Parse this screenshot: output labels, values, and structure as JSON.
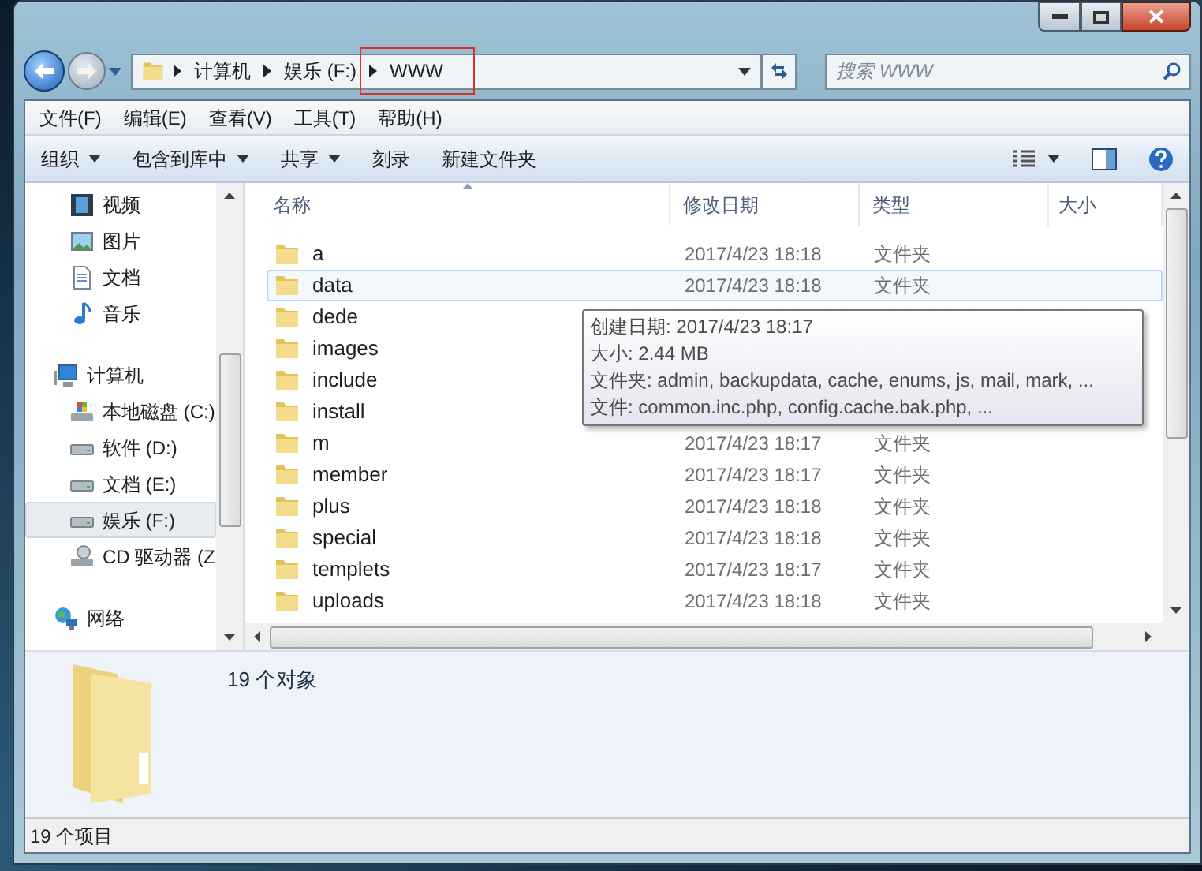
{
  "address_bar": {
    "crumbs": [
      {
        "label": "计算机",
        "highlighted": false
      },
      {
        "label": "娱乐 (F:)",
        "highlighted": false
      },
      {
        "label": "WWW",
        "highlighted": true
      }
    ]
  },
  "search": {
    "placeholder": "搜索 WWW"
  },
  "menu": [
    "文件(F)",
    "编辑(E)",
    "查看(V)",
    "工具(T)",
    "帮助(H)"
  ],
  "toolbar": [
    {
      "label": "组织",
      "dropdown": true
    },
    {
      "label": "包含到库中",
      "dropdown": true
    },
    {
      "label": "共享",
      "dropdown": true
    },
    {
      "label": "刻录",
      "dropdown": false
    },
    {
      "label": "新建文件夹",
      "dropdown": false
    }
  ],
  "nav": [
    {
      "items": [
        {
          "label": "视频",
          "kind": "video",
          "selected": false
        },
        {
          "label": "图片",
          "kind": "picture",
          "selected": false
        },
        {
          "label": "文档",
          "kind": "document",
          "selected": false
        },
        {
          "label": "音乐",
          "kind": "music",
          "selected": false
        }
      ]
    },
    {
      "items": [
        {
          "label": "计算机",
          "kind": "computer",
          "selected": false
        },
        {
          "label": "本地磁盘 (C:)",
          "kind": "system-drive",
          "selected": false
        },
        {
          "label": "软件 (D:)",
          "kind": "drive",
          "selected": false
        },
        {
          "label": "文档 (E:)",
          "kind": "drive",
          "selected": false
        },
        {
          "label": "娱乐 (F:)",
          "kind": "drive",
          "selected": true
        },
        {
          "label": "CD 驱动器 (Z",
          "kind": "cd",
          "selected": false
        }
      ]
    },
    {
      "items": [
        {
          "label": "网络",
          "kind": "network",
          "selected": false
        }
      ]
    }
  ],
  "table": {
    "columns": [
      "名称",
      "修改日期",
      "类型",
      "大小"
    ],
    "rows": [
      {
        "name": "a",
        "modified": "2017/4/23 18:18",
        "type": "文件夹",
        "hovered": false
      },
      {
        "name": "data",
        "modified": "2017/4/23 18:18",
        "type": "文件夹",
        "hovered": true
      },
      {
        "name": "dede",
        "hovered": false
      },
      {
        "name": "images",
        "hovered": false
      },
      {
        "name": "include",
        "hovered": false
      },
      {
        "name": "install",
        "hovered": false
      },
      {
        "name": "m",
        "modified": "2017/4/23 18:17",
        "type": "文件夹",
        "hovered": false
      },
      {
        "name": "member",
        "modified": "2017/4/23 18:17",
        "type": "文件夹",
        "hovered": false
      },
      {
        "name": "plus",
        "modified": "2017/4/23 18:18",
        "type": "文件夹",
        "hovered": false
      },
      {
        "name": "special",
        "modified": "2017/4/23 18:18",
        "type": "文件夹",
        "hovered": false
      },
      {
        "name": "templets",
        "modified": "2017/4/23 18:17",
        "type": "文件夹",
        "hovered": false
      },
      {
        "name": "uploads",
        "modified": "2017/4/23 18:18",
        "type": "文件夹",
        "hovered": false
      }
    ]
  },
  "tooltip": [
    "创建日期: 2017/4/23 18:17",
    "大小: 2.44 MB",
    "文件夹: admin, backupdata, cache, enums, js, mail, mark, ...",
    "文件: common.inc.php, config.cache.bak.php, ..."
  ],
  "details": {
    "summary": "19 个对象"
  },
  "status_bar": "19 个项目"
}
